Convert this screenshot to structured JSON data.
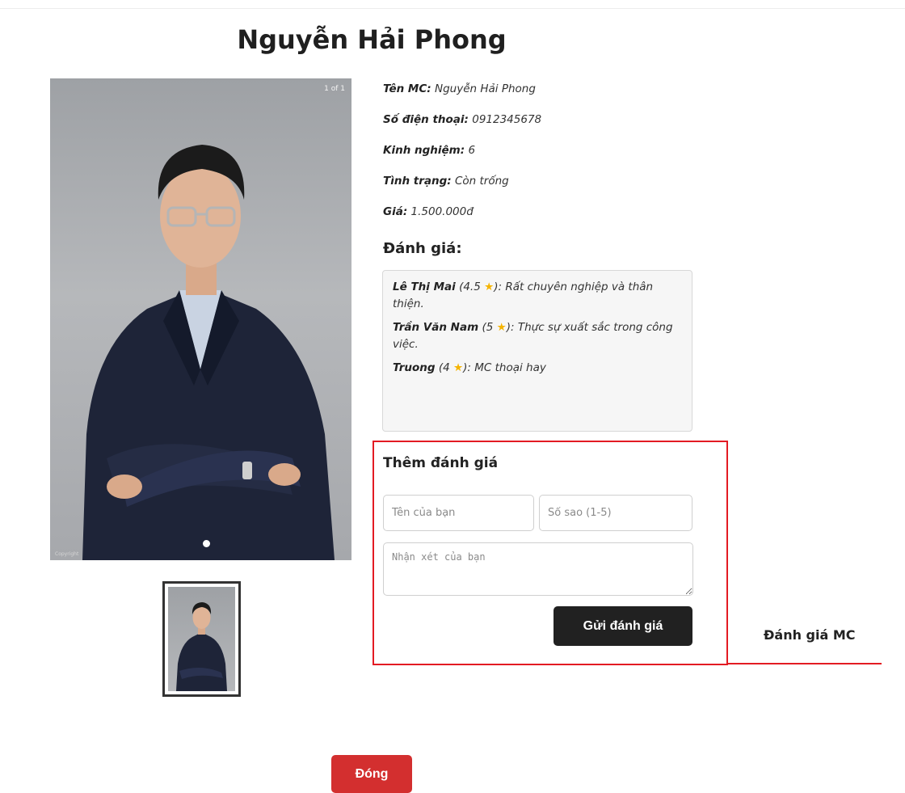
{
  "modal": {
    "title": "Nguyễn Hải Phong",
    "photo_counter": "1 of 1",
    "photo_watermark": "Copyright"
  },
  "info": {
    "name_label": "Tên MC:",
    "name_value": "Nguyễn Hải Phong",
    "phone_label": "Số điện thoại:",
    "phone_value": "0912345678",
    "experience_label": "Kinh nghiệm:",
    "experience_value": "6",
    "status_label": "Tình trạng:",
    "status_value": "Còn trống",
    "price_label": "Giá:",
    "price_value": "1.500.000đ"
  },
  "reviews": {
    "heading": "Đánh giá:",
    "items": [
      {
        "author": "Lê Thị Mai",
        "rating_prefix": "(4.5",
        "rating_suffix": "):",
        "comment": "Rất chuyên nghiệp và thân thiện."
      },
      {
        "author": "Trần Văn Nam",
        "rating_prefix": "(5",
        "rating_suffix": "):",
        "comment": "Thực sự xuất sắc trong công việc."
      },
      {
        "author": "Truong",
        "rating_prefix": "(4",
        "rating_suffix": "):",
        "comment": "MC thoại hay"
      }
    ],
    "star_icon": "star-icon"
  },
  "add_review": {
    "title": "Thêm đánh giá",
    "name_placeholder": "Tên của bạn",
    "stars_placeholder": "Số sao (1-5)",
    "comment_placeholder": "Nhận xét của bạn",
    "submit_label": "Gửi đánh giá"
  },
  "annotation": {
    "label": "Đánh giá MC",
    "color": "#e31b23"
  },
  "footer": {
    "close_label": "Đóng",
    "close_color": "#d32f2f"
  }
}
